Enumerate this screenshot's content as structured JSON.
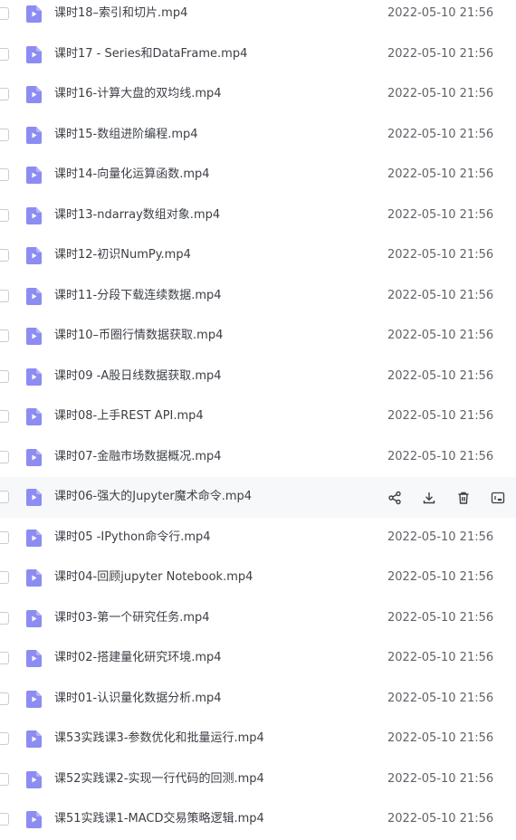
{
  "files": [
    {
      "name": "课时18–索引和切片.mp4",
      "date": "2022-05-10 21:56"
    },
    {
      "name": "课时17 - Series和DataFrame.mp4",
      "date": "2022-05-10 21:56"
    },
    {
      "name": "课时16-计算大盘的双均线.mp4",
      "date": "2022-05-10 21:56"
    },
    {
      "name": "课时15-数组进阶编程.mp4",
      "date": "2022-05-10 21:56"
    },
    {
      "name": "课时14-向量化运算函数.mp4",
      "date": "2022-05-10 21:56"
    },
    {
      "name": "课时13-ndarray数组对象.mp4",
      "date": "2022-05-10 21:56"
    },
    {
      "name": "课时12-初识NumPy.mp4",
      "date": "2022-05-10 21:56"
    },
    {
      "name": "课时11-分段下载连续数据.mp4",
      "date": "2022-05-10 21:56"
    },
    {
      "name": "课时10–币圈行情数据获取.mp4",
      "date": "2022-05-10 21:56"
    },
    {
      "name": "课时09 -A股日线数据获取.mp4",
      "date": "2022-05-10 21:56"
    },
    {
      "name": "课时08-上手REST API.mp4",
      "date": "2022-05-10 21:56"
    },
    {
      "name": "课时07-金融市场数据概况.mp4",
      "date": "2022-05-10 21:56"
    },
    {
      "name": "课时06-强大的Jupyter魔术命令.mp4",
      "date": "",
      "hovered": true
    },
    {
      "name": "课时05 -IPython命令行.mp4",
      "date": "2022-05-10 21:56"
    },
    {
      "name": "课时04-回顾jupyter Notebook.mp4",
      "date": "2022-05-10 21:56"
    },
    {
      "name": "课时03-第一个研究任务.mp4",
      "date": "2022-05-10 21:56"
    },
    {
      "name": "课时02-搭建量化研究环境.mp4",
      "date": "2022-05-10 21:56"
    },
    {
      "name": "课时01-认识量化数据分析.mp4",
      "date": "2022-05-10 21:56"
    },
    {
      "name": "课53实践课3-参数优化和批量运行.mp4",
      "date": "2022-05-10 21:56"
    },
    {
      "name": "课52实践课2-实现一行代码的回测.mp4",
      "date": "2022-05-10 21:56"
    },
    {
      "name": "课51实践课1-MACD交易策略逻辑.mp4",
      "date": "2022-05-10 21:56"
    }
  ],
  "hover_actions": [
    "share-icon",
    "download-icon",
    "delete-icon",
    "more-icon"
  ],
  "colors": {
    "file_icon": "#8c8cf2",
    "action_icon": "#3b3f45",
    "hover_row": "#f7f8fa"
  }
}
